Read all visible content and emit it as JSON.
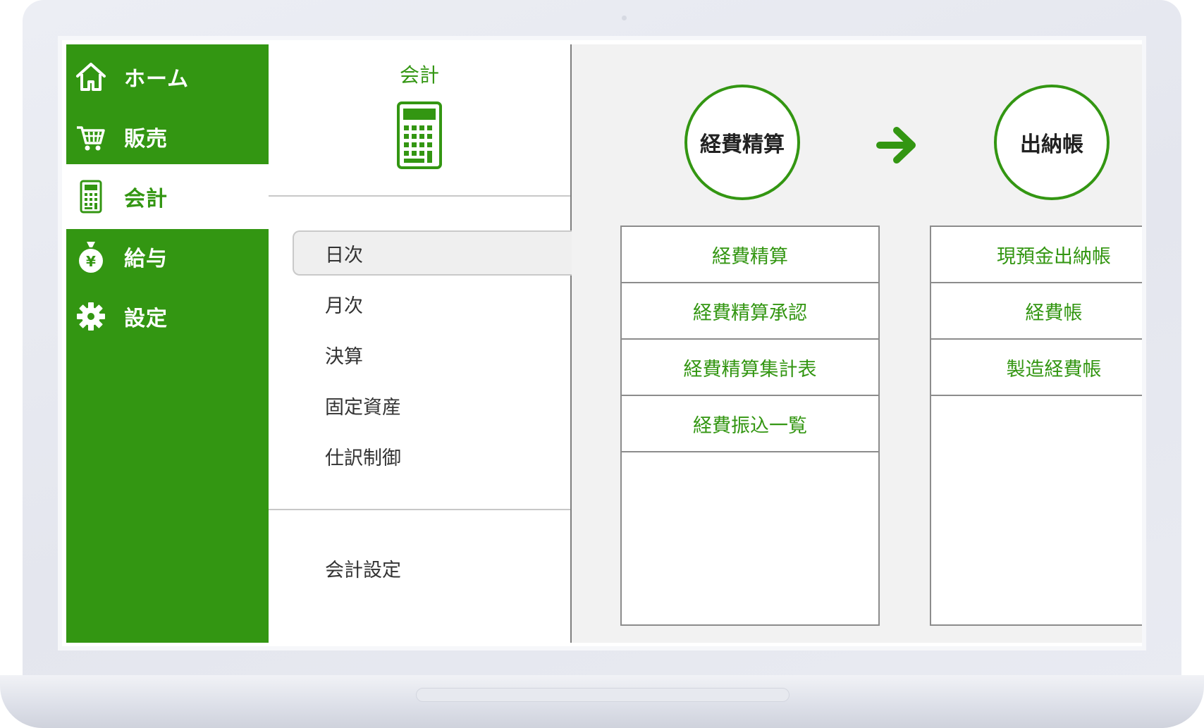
{
  "sidebar": {
    "items": [
      {
        "label": "ホーム",
        "icon": "home-icon"
      },
      {
        "label": "販売",
        "icon": "cart-icon"
      },
      {
        "label": "会計",
        "icon": "calculator-icon",
        "active": true
      },
      {
        "label": "給与",
        "icon": "money-bag-icon"
      },
      {
        "label": "設定",
        "icon": "gear-icon"
      }
    ]
  },
  "menu": {
    "title": "会計",
    "icon": "calculator-icon",
    "items": [
      {
        "label": "日次",
        "selected": true
      },
      {
        "label": "月次"
      },
      {
        "label": "決算"
      },
      {
        "label": "固定資産"
      },
      {
        "label": "仕訳制御"
      }
    ],
    "footer_item": "会計設定"
  },
  "content": {
    "columns": [
      {
        "heading": "経費精算",
        "links": [
          "経費精算",
          "経費精算承認",
          "経費精算集計表",
          "経費振込一覧"
        ]
      },
      {
        "heading": "出納帳",
        "links": [
          "現預金出納帳",
          "経費帳",
          "製造経費帳"
        ]
      }
    ],
    "arrow_icon": "arrow-right-icon"
  },
  "colors": {
    "brand_green": "#339612",
    "content_bg": "#f2f2f2",
    "selected_bg": "#efefef"
  }
}
